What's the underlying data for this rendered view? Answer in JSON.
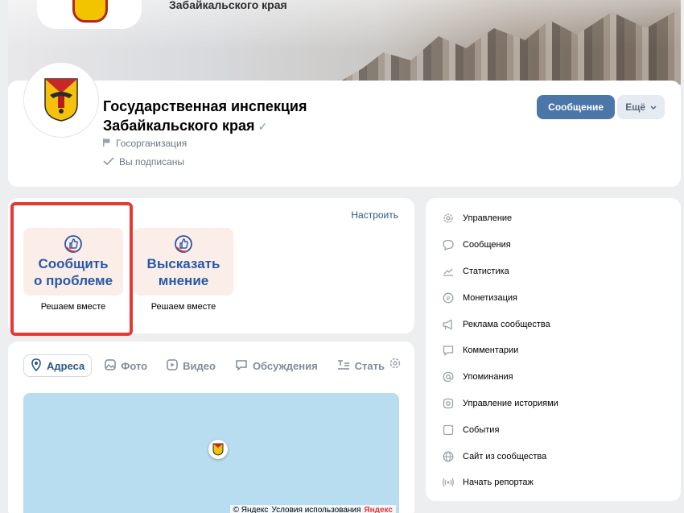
{
  "cover": {
    "subtitle": "Забайкальского края"
  },
  "header": {
    "title_line1": "Государственная инспекция",
    "title_line2": "Забайкальского края",
    "verified_mark": "✓",
    "category": "Госорганизация",
    "subscription_status": "Вы подписаны",
    "message_button": "Сообщение",
    "more_button": "Ещё"
  },
  "widgets": {
    "configure_link": "Настроить",
    "tiles": [
      {
        "line1": "Сообщить",
        "line2": "о проблеме",
        "caption": "Решаем вместе"
      },
      {
        "line1": "Высказать",
        "line2": "мнение",
        "caption": "Решаем вместе"
      }
    ]
  },
  "tabs": [
    {
      "label": "Адреса",
      "icon": "location-icon",
      "active": true
    },
    {
      "label": "Фото",
      "icon": "photo-icon",
      "active": false
    },
    {
      "label": "Видео",
      "icon": "video-icon",
      "active": false
    },
    {
      "label": "Обсуждения",
      "icon": "discussion-icon",
      "active": false
    },
    {
      "label": "Стать",
      "icon": "article-icon",
      "active": false
    }
  ],
  "map": {
    "copyright": "© Яндекс",
    "terms": "Условия использования",
    "brand": "Яндекс"
  },
  "menu": {
    "items": [
      {
        "label": "Управление",
        "icon": "gear-icon"
      },
      {
        "label": "Сообщения",
        "icon": "message-icon"
      },
      {
        "label": "Статистика",
        "icon": "chart-icon"
      },
      {
        "label": "Монетизация",
        "icon": "coin-icon"
      },
      {
        "label": "Реклама сообщества",
        "icon": "megaphone-icon"
      },
      {
        "label": "Комментарии",
        "icon": "comment-icon"
      },
      {
        "label": "Упоминания",
        "icon": "at-icon"
      },
      {
        "label": "Управление историями",
        "icon": "stories-icon"
      },
      {
        "label": "События",
        "icon": "event-icon"
      },
      {
        "label": "Сайт из сообщества",
        "icon": "globe-icon"
      },
      {
        "label": "Начать репортаж",
        "icon": "broadcast-icon"
      }
    ]
  },
  "colors": {
    "accent": "#4a76a8",
    "link": "#2a5885",
    "highlight": "#e53935",
    "tile_bg": "#fbeee9",
    "tile_text": "#2759a6"
  }
}
